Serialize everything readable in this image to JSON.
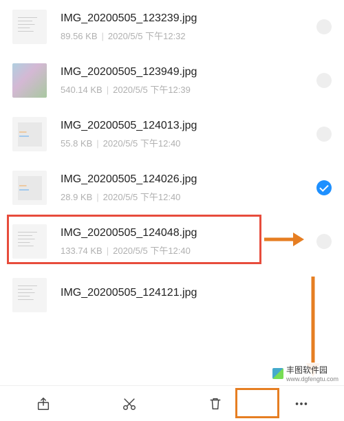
{
  "files": [
    {
      "name": "IMG_20200505_123239.jpg",
      "size": "89.56 KB",
      "date": "2020/5/5 下午12:32",
      "selected": false,
      "thumb": "doc"
    },
    {
      "name": "IMG_20200505_123949.jpg",
      "size": "540.14 KB",
      "date": "2020/5/5 下午12:39",
      "selected": false,
      "thumb": "photo"
    },
    {
      "name": "IMG_20200505_124013.jpg",
      "size": "55.8 KB",
      "date": "2020/5/5 下午12:40",
      "selected": false,
      "thumb": "chart"
    },
    {
      "name": "IMG_20200505_124026.jpg",
      "size": "28.9 KB",
      "date": "2020/5/5 下午12:40",
      "selected": true,
      "thumb": "chart"
    },
    {
      "name": "IMG_20200505_124048.jpg",
      "size": "133.74 KB",
      "date": "2020/5/5 下午12:40",
      "selected": false,
      "thumb": "doc"
    },
    {
      "name": "IMG_20200505_124121.jpg",
      "size": "",
      "date": "",
      "selected": false,
      "thumb": "doc"
    }
  ],
  "toolbar": {
    "share": "share",
    "cut": "cut",
    "delete": "delete",
    "more": "more"
  },
  "watermark": {
    "title": "丰图软件园",
    "url": "www.dgfengtu.com"
  },
  "colors": {
    "highlight_red": "#e74c3c",
    "highlight_orange": "#e67e22",
    "check_blue": "#1e90ff"
  }
}
